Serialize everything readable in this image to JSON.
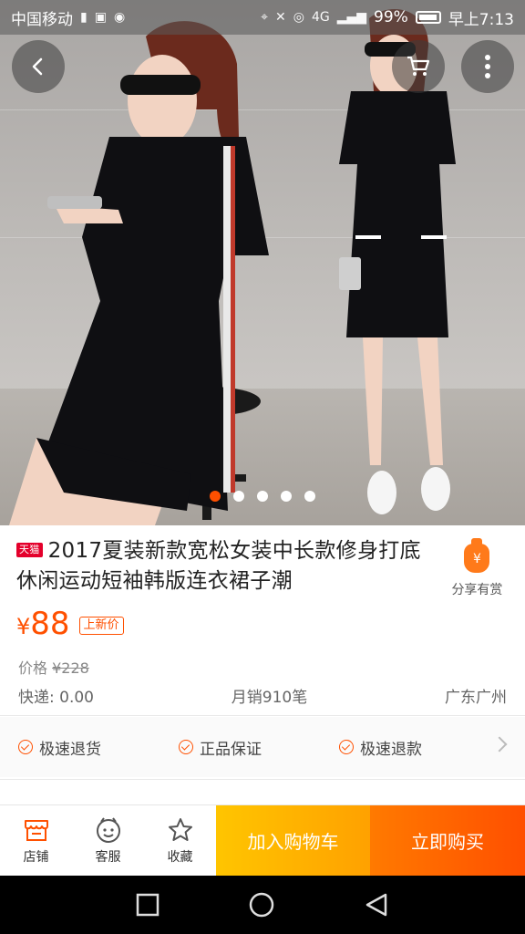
{
  "status_bar": {
    "carrier": "中国移动",
    "battery_percent": "99%",
    "time": "早上7:13",
    "network": "4G"
  },
  "gallery": {
    "image_count": 5,
    "active_index": 0,
    "icons": [
      "back-icon",
      "cart-icon",
      "more-icon"
    ]
  },
  "product": {
    "badge": "天猫",
    "title": "2017夏装新款宽松女装中长款修身打底休闲运动短袖韩版连衣裙子潮",
    "price_currency": "¥",
    "price": "88",
    "price_tag": "上新价",
    "original_price_label": "价格",
    "original_price": "¥228",
    "shipping": "快递: 0.00",
    "monthly_sales": "月销910笔",
    "location": "广东广州"
  },
  "share": {
    "label": "分享有赏",
    "icon": "¥"
  },
  "guarantees": [
    {
      "label": "极速退货"
    },
    {
      "label": "正品保证"
    },
    {
      "label": "极速退款"
    }
  ],
  "action_bar": {
    "shop": "店铺",
    "service": "客服",
    "favorite": "收藏",
    "add_to_cart": "加入购物车",
    "buy_now": "立即购买"
  },
  "colors": {
    "accent": "#ff5000",
    "cart_button": "#ffb400",
    "buy_button": "#ff5a00"
  }
}
